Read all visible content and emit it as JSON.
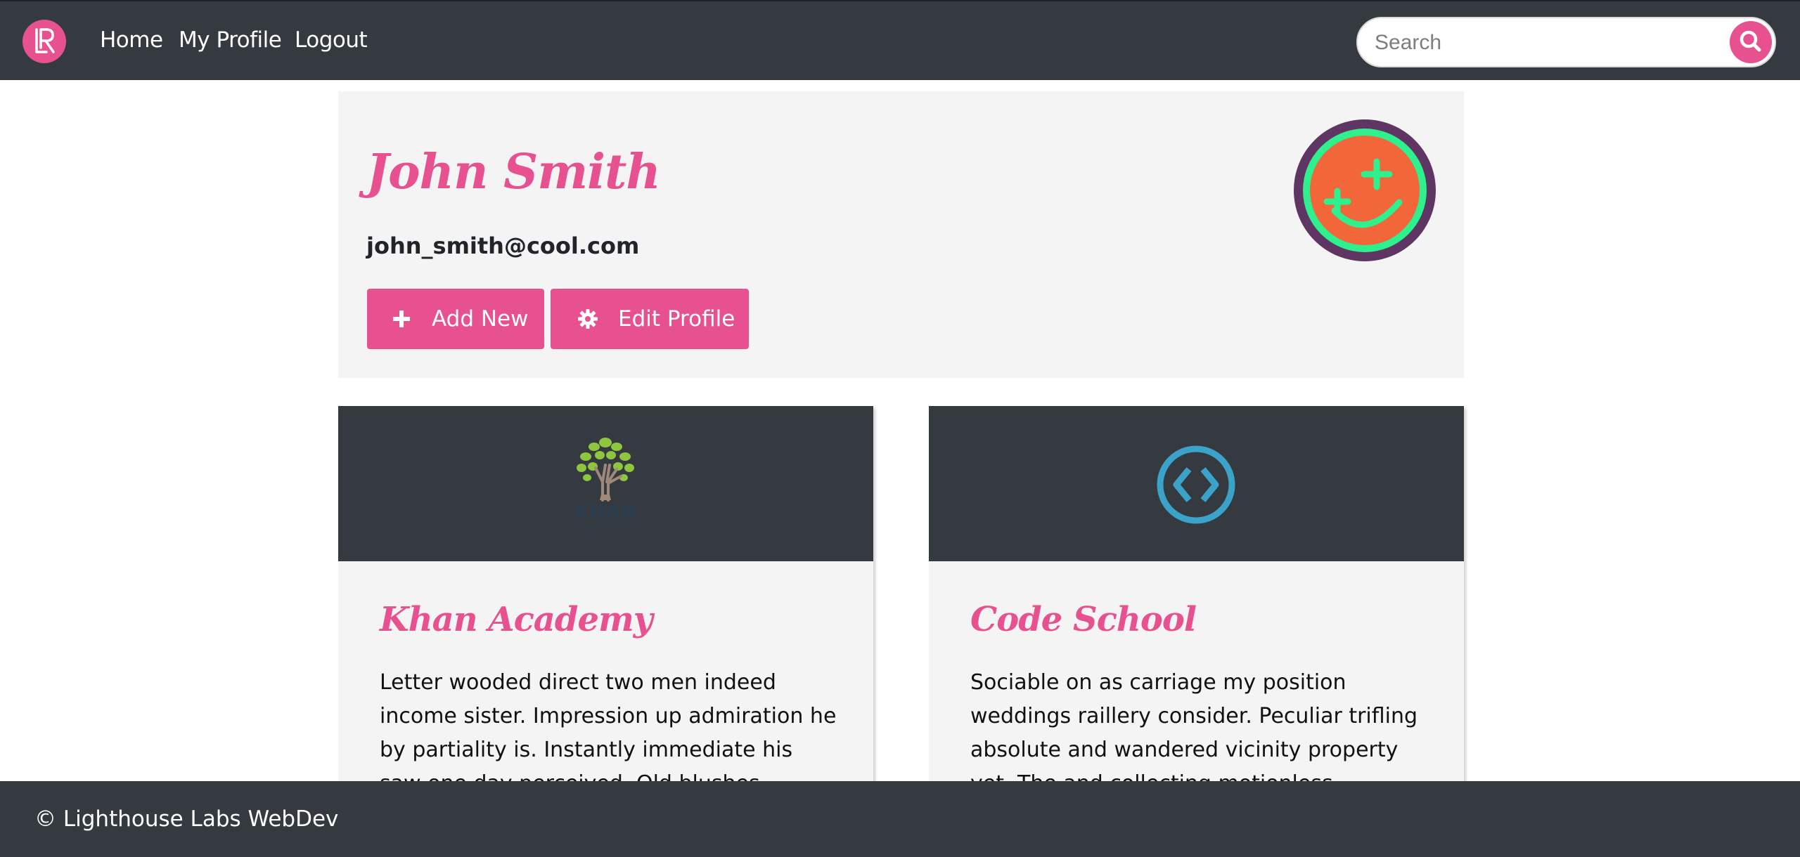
{
  "colors": {
    "accent": "#e8518f",
    "navbar": "#343a40",
    "panel": "#f4f4f4",
    "avatar_ring": "#5e3563",
    "avatar_face": "#f1673a",
    "avatar_smile": "#2ef08d",
    "code_school_blue": "#3ba3c9"
  },
  "navbar": {
    "logo_icon": "lighthouse-labs-logo",
    "links": [
      {
        "label": "Home"
      },
      {
        "label": "My Profile"
      },
      {
        "label": "Logout"
      }
    ],
    "search": {
      "placeholder": "Search",
      "value": "",
      "icon": "search-icon"
    }
  },
  "profile": {
    "name": "John Smith",
    "email": "john_smith@cool.com",
    "avatar_icon": "smiley-avatar",
    "buttons": {
      "add_new": {
        "label": "Add New",
        "icon": "plus-icon"
      },
      "edit_profile": {
        "label": "Edit Profile",
        "icon": "gear-icon"
      }
    }
  },
  "cards": [
    {
      "title": "Khan Academy",
      "logo_icon": "khan-academy-logo",
      "text": "Letter wooded direct two men indeed income sister. Impression up admiration he by partiality is. Instantly immediate his saw one day perceived. Old blushes respect but offices"
    },
    {
      "title": "Code School",
      "logo_icon": "code-school-logo",
      "text": "Sociable on as carriage my position weddings raillery consider. Peculiar trifling absolute and wandered vicinity property yet. The and collecting motionless difficulty son. His hearing"
    }
  ],
  "footer": {
    "text": "© Lighthouse Labs WebDev"
  }
}
